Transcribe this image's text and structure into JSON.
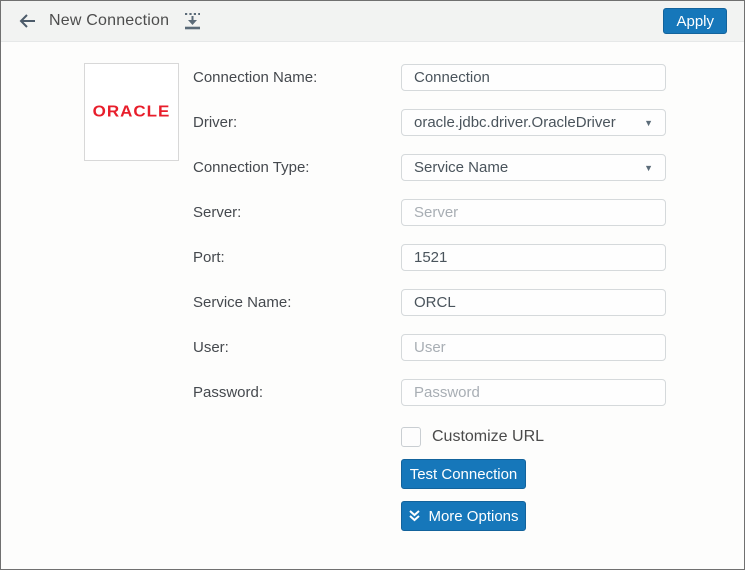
{
  "header": {
    "title": "New Connection",
    "back_icon": "arrow-left",
    "import_icon": "import-connection",
    "apply_label": "Apply"
  },
  "logo": {
    "brand_text": "ORACLE",
    "brand_color": "#e81e2b"
  },
  "form": {
    "fields": [
      {
        "label": "Connection Name:",
        "type": "text",
        "value": "Connection",
        "placeholder": ""
      },
      {
        "label": "Driver:",
        "type": "select",
        "value": "oracle.jdbc.driver.OracleDriver"
      },
      {
        "label": "Connection Type:",
        "type": "select",
        "value": "Service Name"
      },
      {
        "label": "Server:",
        "type": "text",
        "value": "",
        "placeholder": "Server"
      },
      {
        "label": "Port:",
        "type": "text",
        "value": "1521",
        "placeholder": ""
      },
      {
        "label": "Service Name:",
        "type": "text",
        "value": "ORCL",
        "placeholder": ""
      },
      {
        "label": "User:",
        "type": "text",
        "value": "",
        "placeholder": "User"
      },
      {
        "label": "Password:",
        "type": "password",
        "value": "",
        "placeholder": "Password"
      }
    ],
    "customize_url": {
      "label": "Customize URL",
      "checked": false
    },
    "test_connection_label": "Test Connection",
    "more_options_label": "More Options",
    "caret_glyph": "▼"
  },
  "colors": {
    "accent_blue": "#1677ba",
    "header_bg": "#f2f3f2",
    "oracle_red": "#e81e2b",
    "window_border": "#707070"
  }
}
